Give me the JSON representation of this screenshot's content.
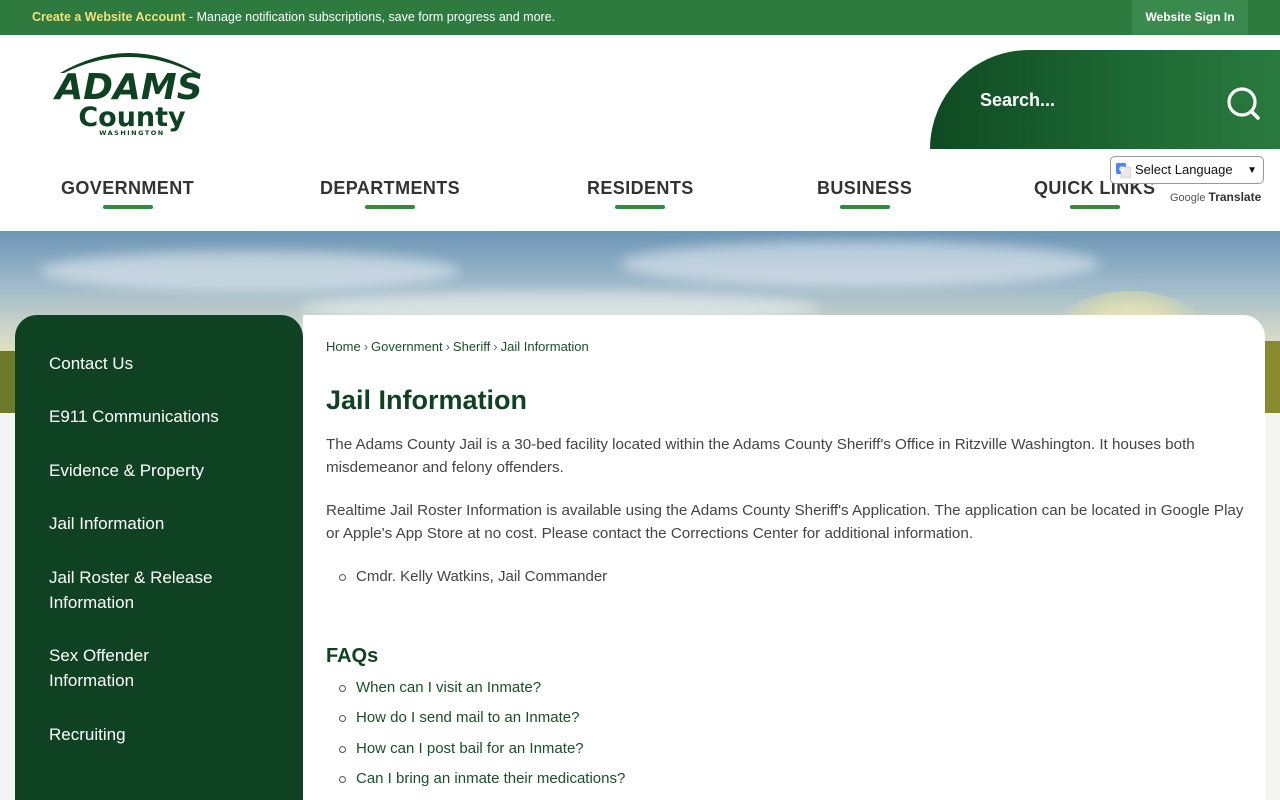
{
  "topbar": {
    "account_link": "Create a Website Account",
    "message": " - Manage notification subscriptions, save form progress and more.",
    "signin": "Website Sign In"
  },
  "logo": {
    "line1": "ADAMS",
    "line2": "County",
    "line3": "WASHINGTON"
  },
  "search": {
    "placeholder": "Search..."
  },
  "nav": {
    "items": [
      "GOVERNMENT",
      "DEPARTMENTS",
      "RESIDENTS",
      "BUSINESS",
      "QUICK LINKS"
    ]
  },
  "translate": {
    "select_label": "Select Language",
    "google": "Google",
    "translate": "Translate"
  },
  "sidebar": {
    "items": [
      "Contact Us",
      "E911 Communications",
      "Evidence & Property",
      "Jail Information",
      "Jail Roster & Release Information",
      "Sex Offender Information",
      "Recruiting"
    ]
  },
  "breadcrumb": [
    "Home",
    "Government",
    "Sheriff",
    "Jail Information"
  ],
  "page": {
    "title": "Jail Information",
    "para1": "The Adams County Jail is a 30-bed facility located within the Adams County Sheriff's Office in Ritzville Washington. It houses both misdemeanor and felony offenders.",
    "para2": "Realtime Jail Roster Information is available using the Adams County Sheriff's Application. The application can be located in Google Play or Apple's App Store at no cost. Please contact the Corrections Center for additional information.",
    "contact": "Cmdr. Kelly Watkins, Jail Commander",
    "faq_heading": "FAQs",
    "faqs": [
      "When can I visit an Inmate?",
      "How do I send mail to an Inmate?",
      "How can I post bail for an Inmate?",
      "Can I bring an inmate their medications?"
    ]
  },
  "colors": {
    "brand_green": "#0f4222",
    "topbar_green": "#2e7a3f",
    "accent_yellow": "#f2e27a",
    "nav_underline": "#2e8b3f"
  }
}
